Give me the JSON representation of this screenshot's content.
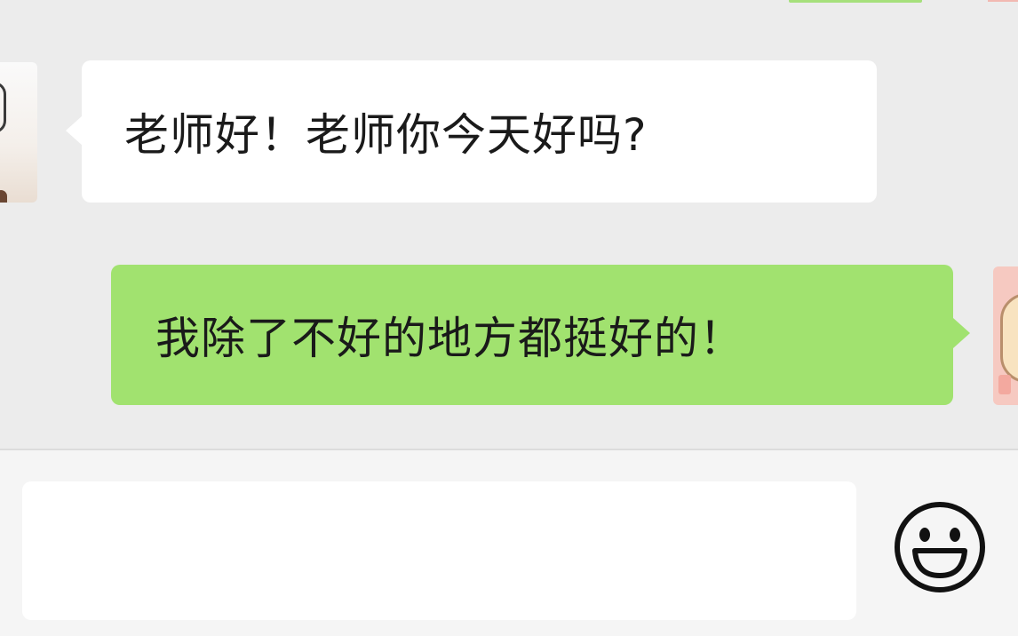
{
  "messages": [
    {
      "sender": "other",
      "text": "老师好！老师你今天好吗?"
    },
    {
      "sender": "self",
      "text": "我除了不好的地方都挺好的！"
    }
  ],
  "input": {
    "value": "",
    "placeholder": ""
  },
  "icons": {
    "emoji_button": "smiley-face-icon"
  },
  "colors": {
    "background": "#ececec",
    "incoming_bubble": "#ffffff",
    "outgoing_bubble": "#a1e26f",
    "input_bar": "#f5f5f5"
  }
}
